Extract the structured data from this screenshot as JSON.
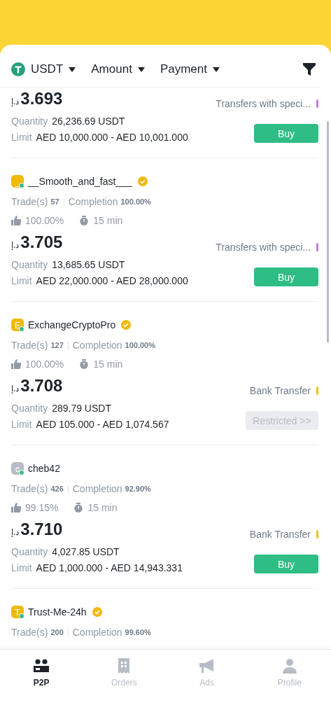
{
  "filters": [
    {
      "label": "USDT",
      "kind": "coin"
    },
    {
      "label": "Amount",
      "kind": "plain"
    },
    {
      "label": "Payment",
      "kind": "plain"
    }
  ],
  "offers": [
    {
      "currency": "د.إ",
      "price": "3.693",
      "quantity_label": "Quantity",
      "quantity": "26,236.69 USDT",
      "limit_label": "Limit",
      "limit": "AED 10,000.000 - AED 10,001.000",
      "payment": {
        "label": "Transfers with speci...",
        "color": "#c77ddb"
      },
      "action": {
        "kind": "buy",
        "label": "Buy"
      }
    },
    {
      "merchant": {
        "name": "__Smooth_and_fast___",
        "avatar_letter": "_",
        "color": "#f0b90b",
        "online": true,
        "verified": true
      },
      "trades_label": "Trade(s)",
      "trades": "57",
      "completion_label": "Completion",
      "completion": "100.00%",
      "rating": "100.00%",
      "time": "15 min",
      "currency": "د.إ",
      "price": "3.705",
      "quantity_label": "Quantity",
      "quantity": "13,685.65 USDT",
      "limit_label": "Limit",
      "limit": "AED 22,000.000 - AED 28,000.000",
      "payment": {
        "label": "Transfers with speci...",
        "color": "#c77ddb"
      },
      "action": {
        "kind": "buy",
        "label": "Buy"
      }
    },
    {
      "merchant": {
        "name": "ExchangeCryptoPro",
        "avatar_letter": "E",
        "color": "#f0b90b",
        "online": true,
        "verified": true
      },
      "trades_label": "Trade(s)",
      "trades": "127",
      "completion_label": "Completion",
      "completion": "100.00%",
      "rating": "100.00%",
      "time": "15 min",
      "currency": "د.إ",
      "price": "3.708",
      "quantity_label": "Quantity",
      "quantity": "289.79 USDT",
      "limit_label": "Limit",
      "limit": "AED 105.000 - AED 1,074.567",
      "payment": {
        "label": "Bank Transfer",
        "color": "#f0c419"
      },
      "action": {
        "kind": "restricted",
        "label": "Restricted >>"
      }
    },
    {
      "merchant": {
        "name": "cheb42",
        "avatar_letter": "c",
        "color": "#b7bdc6",
        "online": true,
        "verified": false
      },
      "trades_label": "Trade(s)",
      "trades": "426",
      "completion_label": "Completion",
      "completion": "92.90%",
      "rating": "99.15%",
      "time": "15 min",
      "currency": "د.إ",
      "price": "3.710",
      "quantity_label": "Quantity",
      "quantity": "4,027.85 USDT",
      "limit_label": "Limit",
      "limit": "AED 1,000.000 - AED 14,943.331",
      "payment": {
        "label": "Bank Transfer",
        "color": "#f0c419"
      },
      "action": {
        "kind": "buy",
        "label": "Buy"
      }
    },
    {
      "merchant": {
        "name": "Trust-Me-24h",
        "avatar_letter": "T",
        "color": "#f0b90b",
        "online": true,
        "verified": true
      },
      "trades_label": "Trade(s)",
      "trades": "200",
      "completion_label": "Completion",
      "completion": "99.60%"
    }
  ],
  "bottom_nav": [
    {
      "label": "P2P",
      "kind": "p2p",
      "selected": true
    },
    {
      "label": "Orders",
      "kind": "orders",
      "selected": false
    },
    {
      "label": "Ads",
      "kind": "ads",
      "selected": false
    },
    {
      "label": "Profile",
      "kind": "profile",
      "selected": false
    }
  ]
}
